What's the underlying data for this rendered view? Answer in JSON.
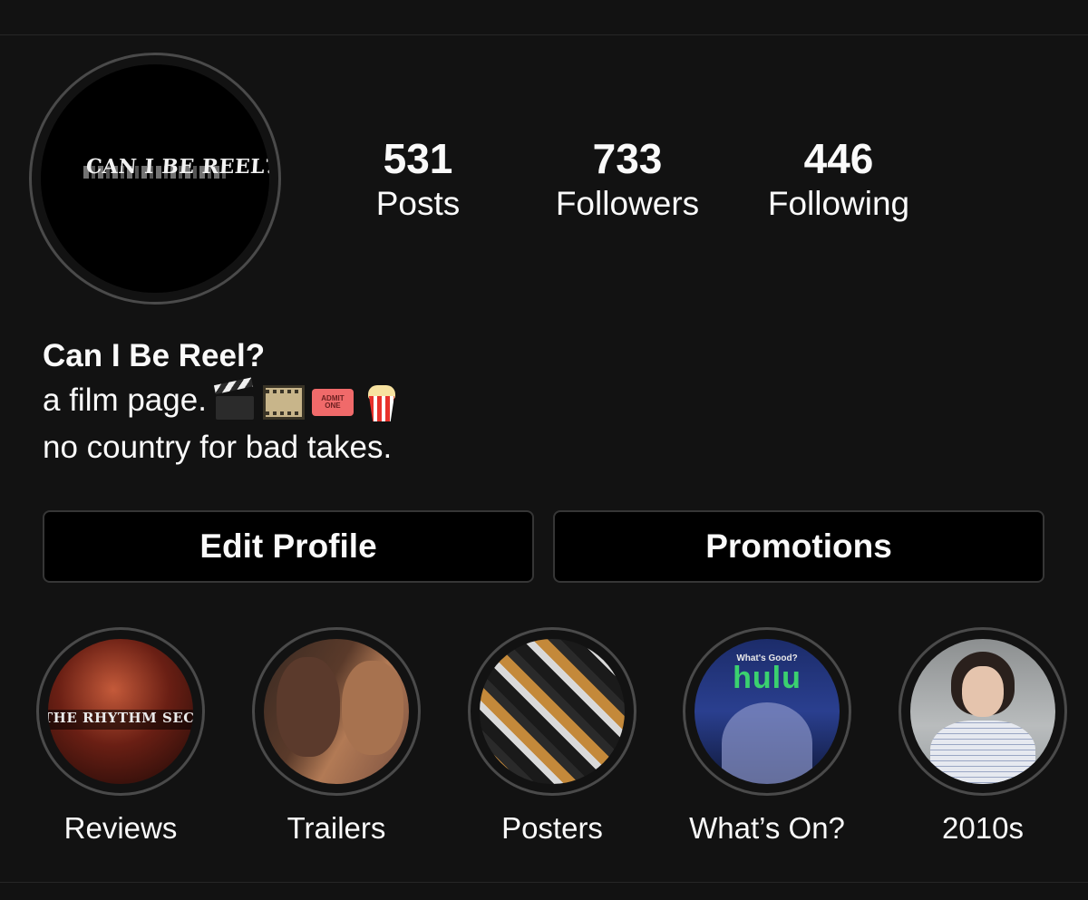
{
  "profile": {
    "avatar_text": "CAN I BE REEL?",
    "stats": [
      {
        "value": "531",
        "label": "Posts"
      },
      {
        "value": "733",
        "label": "Followers"
      },
      {
        "value": "446",
        "label": "Following"
      }
    ],
    "name": "Can I Be Reel?",
    "bio_line1": "a film page.",
    "bio_emojis": [
      "clapper-board",
      "film-frames",
      "ticket",
      "popcorn"
    ],
    "ticket_text_1": "ADMIT",
    "ticket_text_2": "ONE",
    "bio_line2": "no country for bad takes."
  },
  "buttons": {
    "edit_profile": "Edit Profile",
    "promotions": "Promotions"
  },
  "highlights": [
    {
      "label": "Reviews",
      "cover_text": "THE RHYTHM SECTION"
    },
    {
      "label": "Trailers"
    },
    {
      "label": "Posters"
    },
    {
      "label": "What’s On?",
      "cover_small": "What's Good?",
      "cover_brand": "hulu"
    },
    {
      "label": "2010s"
    }
  ],
  "colors": {
    "background": "#121212",
    "text": "#fafafa",
    "border": "#363636",
    "hulu_green": "#3bd16f"
  }
}
